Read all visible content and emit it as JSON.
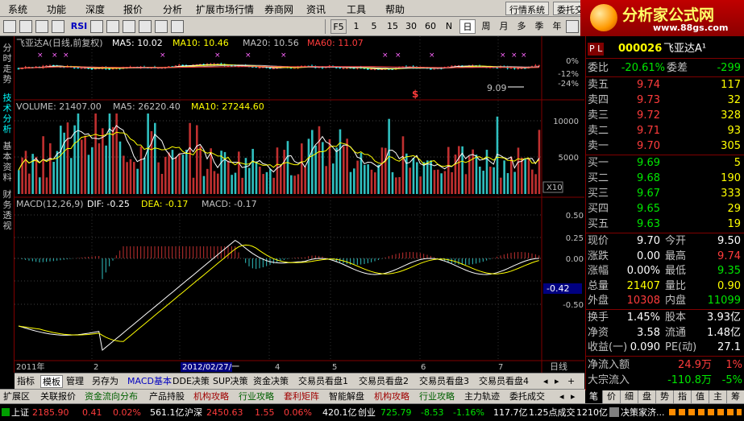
{
  "menu": {
    "items": [
      "系统",
      "功能",
      "深度",
      "报价",
      "分析",
      "扩展市场行情",
      "券商网",
      "资讯",
      "工具",
      "帮助"
    ],
    "right_buttons": [
      "行情系统",
      "委托交"
    ]
  },
  "toolbar": {
    "icons": [
      "pointer-icon",
      "line-tool-icon",
      "chart-type-icon",
      "refresh-icon",
      "rsi-icon",
      "stock-picker-icon",
      "cross-icon",
      "zoom-in-icon",
      "zoom-out-icon",
      "left-icon",
      "right-icon",
      "settings-icon",
      "period-menu-icon"
    ],
    "rsi_label": "RSI",
    "f5_label": "F5",
    "periods": [
      "1",
      "5",
      "15",
      "30",
      "60",
      "N",
      "日",
      "周",
      "月",
      "多",
      "季",
      "年"
    ],
    "active_period": "日"
  },
  "logo": {
    "title": "分析家公式网",
    "url": "www.88gs.com"
  },
  "left_tabs": [
    "分时走势",
    "技术分析",
    "基本资料",
    "财务透视"
  ],
  "price_panel": {
    "header_stock": "飞亚达A(日线,前复权)",
    "ma5_label": "MA5: 10.02",
    "ma10_label": "MA10: 10.46",
    "ma20_label": "MA20: 10.56",
    "ma60_label": "MA60: 11.07",
    "pct_labels": [
      "0%",
      "-12%",
      "-24%"
    ],
    "low_label": "9.09",
    "dollar_mark": "$"
  },
  "volume_panel": {
    "header_volume": "VOLUME: 21407.00",
    "ma5_label": "MA5: 26220.40",
    "ma10_label": "MA10: 27244.60",
    "axis_labels": [
      "10000",
      "5000"
    ],
    "unit_label": "X10"
  },
  "macd_panel": {
    "header_macd": "MACD(12,26,9)",
    "dif_label": "DIF: -0.25",
    "dea_label": "DEA: -0.17",
    "macd_label": "MACD: -0.17",
    "axis_labels": [
      "0.50",
      "0.25",
      "0.00",
      "-0.25",
      "-0.50"
    ],
    "current_value": "-0.42"
  },
  "time_axis": {
    "labels": [
      "2011年",
      "2",
      "3",
      "4",
      "5",
      "6",
      "7"
    ],
    "cursor_date": "2012/02/27/一",
    "period_label": "日线"
  },
  "quote": {
    "code_prefix": "P L",
    "code": "000026",
    "name": "飞亚达A¹",
    "wei_bi_label": "委比",
    "wei_bi_value": "-20.61%",
    "wei_cha_label": "委差",
    "wei_cha_value": "-299",
    "asks": [
      {
        "label": "卖五",
        "price": "9.74",
        "vol": "117"
      },
      {
        "label": "卖四",
        "price": "9.73",
        "vol": "32"
      },
      {
        "label": "卖三",
        "price": "9.72",
        "vol": "328"
      },
      {
        "label": "卖二",
        "price": "9.71",
        "vol": "93"
      },
      {
        "label": "卖一",
        "price": "9.70",
        "vol": "305"
      }
    ],
    "bids": [
      {
        "label": "买一",
        "price": "9.69",
        "vol": "5"
      },
      {
        "label": "买二",
        "price": "9.68",
        "vol": "190"
      },
      {
        "label": "买三",
        "price": "9.67",
        "vol": "333"
      },
      {
        "label": "买四",
        "price": "9.65",
        "vol": "29"
      },
      {
        "label": "买五",
        "price": "9.63",
        "vol": "19"
      }
    ],
    "stats": [
      {
        "l1": "现价",
        "v1": "9.70",
        "l2": "今开",
        "v2": "9.50"
      },
      {
        "l1": "涨跌",
        "v1": "0.00",
        "l2": "最高",
        "v2": "9.74"
      },
      {
        "l1": "涨幅",
        "v1": "0.00%",
        "l2": "最低",
        "v2": "9.35"
      },
      {
        "l1": "总量",
        "v1": "21407",
        "l2": "量比",
        "v2": "0.90"
      },
      {
        "l1": "外盘",
        "v1": "10308",
        "l2": "内盘",
        "v2": "11099"
      }
    ],
    "stats2": [
      {
        "l1": "换手",
        "v1": "1.45%",
        "l2": "股本",
        "v2": "3.93亿"
      },
      {
        "l1": "净资",
        "v1": "3.58",
        "l2": "流通",
        "v2": "1.48亿"
      },
      {
        "l1": "收益(一)",
        "v1": "0.090",
        "l2": "PE(动)",
        "v2": "27.1"
      }
    ],
    "flow": [
      {
        "label": "净流入额",
        "value": "24.9万",
        "pct": "1%"
      },
      {
        "label": "大宗流入",
        "value": "-110.8万",
        "pct": "-5%"
      }
    ]
  },
  "bottom_tabs": {
    "row1": [
      "指标",
      "模板",
      "管理",
      "另存为",
      "MACD基本",
      "DDE决策",
      "SUP决策",
      "资金决策",
      "交易员看盘1",
      "交易员看盘2",
      "交易员看盘3",
      "交易员看盘4"
    ],
    "row1_active": "模板",
    "row2": [
      "扩展区",
      "关联报价",
      "资金流向分布",
      "产品持股",
      "机构攻略",
      "行业攻略",
      "套利矩阵",
      "智能解盘",
      "机构攻略",
      "行业攻略",
      "主力轨迹",
      "委托成交"
    ],
    "right_tabs": [
      "笔",
      "价",
      "细",
      "盘",
      "势",
      "指",
      "值",
      "主",
      "筹"
    ],
    "right_active": "笔"
  },
  "status_bar": {
    "sh_label": "上证",
    "sh_index": "2185.90",
    "sh_change": "0.41",
    "sh_pct": "0.02%",
    "sh_amount": "561.1亿",
    "hs_label": "沪深",
    "hs_index": "2450.63",
    "hs_change": "1.55",
    "hs_pct": "0.06%",
    "hs_amount": "420.1亿",
    "cy_label": "创业",
    "cy_index": "725.79",
    "cy_change": "-8.53",
    "cy_pct": "-1.16%",
    "cy_amount": "117.7亿",
    "deal_label": "1.25点成交",
    "deal_vol": "1210亿",
    "news": "决策家济..."
  },
  "colors": {
    "up": "#ff3c3c",
    "down": "#00ffff",
    "frame": "#800000",
    "panel_bg": "#000000"
  }
}
